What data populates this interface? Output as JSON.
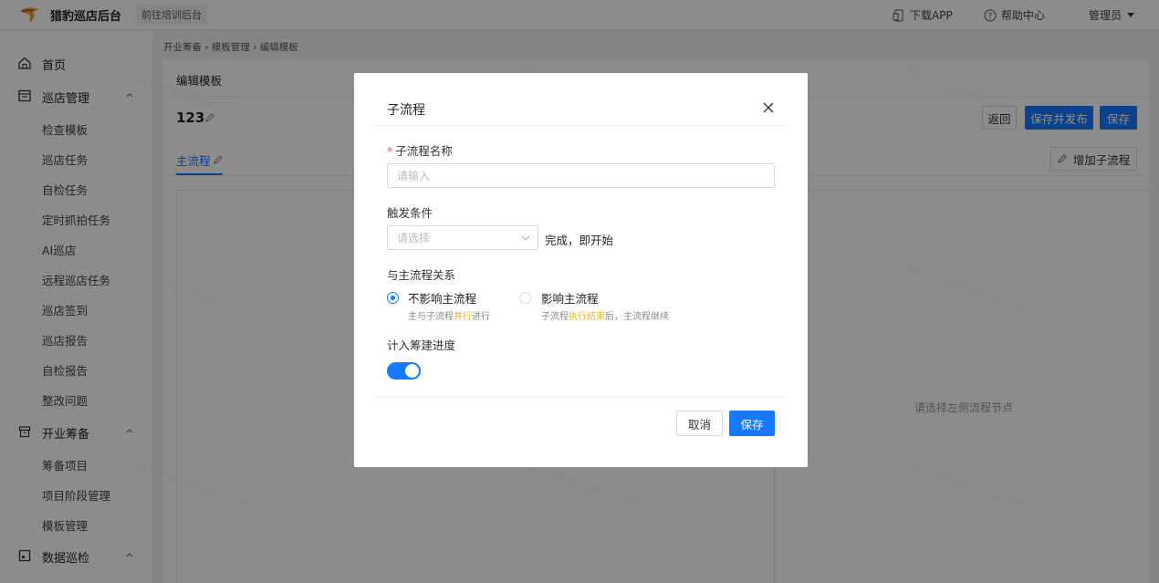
{
  "topbar": {
    "brand": "猎豹巡店后台",
    "training_button": "前往培训后台",
    "download_app": "下载APP",
    "help_center": "帮助中心",
    "admin": "管理员"
  },
  "sidebar": {
    "home": "首页",
    "groups": [
      {
        "label": "巡店管理",
        "items": [
          "检查模板",
          "巡店任务",
          "自检任务",
          "定时抓拍任务",
          "AI巡店",
          "远程巡店任务",
          "巡店签到",
          "巡店报告",
          "自检报告",
          "整改问题"
        ]
      },
      {
        "label": "开业筹备",
        "items": [
          "筹备项目",
          "项目阶段管理",
          "模板管理"
        ]
      },
      {
        "label": "数据巡检",
        "items": []
      }
    ]
  },
  "breadcrumb": "开业筹备 › 模板管理 › 编辑模板",
  "card": {
    "title": "编辑模板",
    "template_name": "123",
    "tab_main": "主流程",
    "btn_back": "返回",
    "btn_save_publish": "保存并发布",
    "btn_save": "保存",
    "btn_add_subflow": "增加子流程",
    "right_placeholder": "请选择左侧流程节点"
  },
  "watermark": "智能开 测量测试账号（47分的2）",
  "modal": {
    "title": "子流程",
    "name_label": "子流程名称",
    "name_placeholder": "请输入",
    "trigger_label": "触发条件",
    "trigger_placeholder": "请选择",
    "trigger_suffix": "完成，即开始",
    "relation_label": "与主流程关系",
    "option_no_effect": "不影响主流程",
    "option_no_effect_desc_pre": "主与子流程",
    "option_no_effect_desc_hl": "并行",
    "option_no_effect_desc_post": "进行",
    "option_effect": "影响主流程",
    "option_effect_desc_pre": "子流程",
    "option_effect_desc_hl": "执行结束",
    "option_effect_desc_post": "后，主流程继续",
    "progress_label": "计入筹建进度",
    "progress_enabled": true,
    "selected_relation": "不影响主流程",
    "btn_cancel": "取消",
    "btn_save": "保存"
  },
  "colors": {
    "primary": "#1677ff",
    "highlight": "#faad14",
    "required": "#ff4d4f"
  }
}
